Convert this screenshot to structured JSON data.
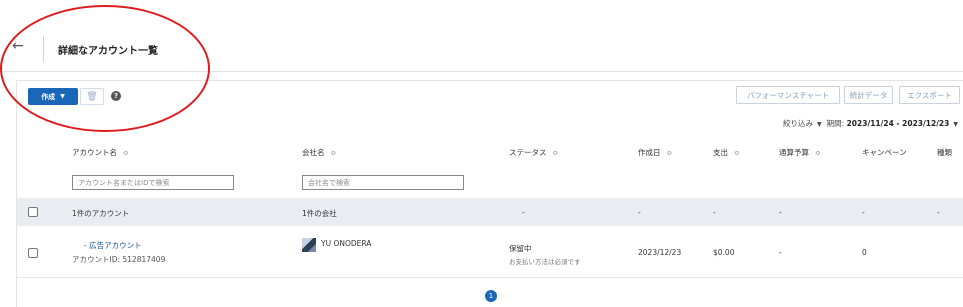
{
  "header": {
    "back_glyph": "←",
    "title": "詳細なアカウント一覧"
  },
  "toolbar": {
    "create_label": "作成",
    "help_glyph": "?",
    "performance_chart_label": "パフォーマンスチャート",
    "stats_label": "統計データ",
    "export_label": "エクスポート"
  },
  "filter": {
    "narrow_label": "絞り込み",
    "period_label": "期間:",
    "period_range": "2023/11/24 - 2023/12/23"
  },
  "table": {
    "columns": [
      "アカウント名",
      "会社名",
      "ステータス",
      "作成日",
      "支出",
      "通算予算",
      "キャンペーン",
      "種類"
    ],
    "search_placeholders": {
      "account": "アカウント名またはIDで検索",
      "company": "会社名で検索"
    },
    "summary": {
      "accounts": "1件のアカウント",
      "companies": "1件の会社",
      "status": "-",
      "created": "-",
      "spend": "-",
      "budget": "-",
      "campaigns": "-",
      "type": "-"
    },
    "rows": [
      {
        "account_name": "- 広告アカウント",
        "account_id": "アカウントID: 512817409",
        "company": "YU ONODERA",
        "status": "保留中",
        "status_sub": "お支払い方法は必須です",
        "created": "2023/12/23",
        "spend": "$0.00",
        "budget": "-",
        "campaigns": "0"
      }
    ]
  },
  "pagination": {
    "current_page": "1"
  },
  "colors": {
    "primary": "#1a66b8",
    "annotation": "#e01b1b",
    "summary_bg": "#e9edf2"
  },
  "icons": [
    "back-arrow-icon",
    "caret-down-icon",
    "trash-icon",
    "help-icon",
    "sort-icon",
    "avatar-icon"
  ]
}
